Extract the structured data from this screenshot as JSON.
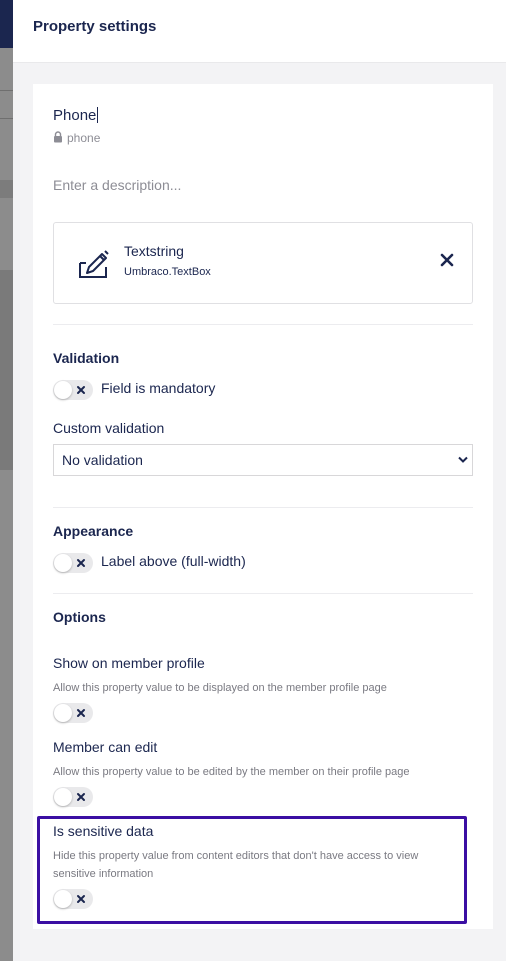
{
  "panel": {
    "title": "Property settings"
  },
  "property": {
    "name": "Phone",
    "alias": "phone",
    "description_placeholder": "Enter a description..."
  },
  "editor": {
    "name": "Textstring",
    "alias": "Umbraco.TextBox",
    "icon": "edit-pen-icon"
  },
  "validation": {
    "title": "Validation",
    "mandatory_label": "Field is mandatory",
    "mandatory": false,
    "custom_label": "Custom validation",
    "custom_value": "No validation"
  },
  "appearance": {
    "title": "Appearance",
    "label_above": "Label above (full-width)",
    "label_above_enabled": false
  },
  "options": {
    "title": "Options",
    "show_on_profile": {
      "label": "Show on member profile",
      "hint": "Allow this property value to be displayed on the member profile page",
      "enabled": false
    },
    "member_can_edit": {
      "label": "Member can edit",
      "hint": "Allow this property value to be edited by the member on their profile page",
      "enabled": false
    },
    "sensitive": {
      "label": "Is sensitive data",
      "hint": "Hide this property value from content editors that don't have access to view sensitive information",
      "enabled": false
    }
  },
  "colors": {
    "text": "#1b264f",
    "highlight": "#3b0fa3",
    "toggle_off": "#e9e9eb"
  }
}
